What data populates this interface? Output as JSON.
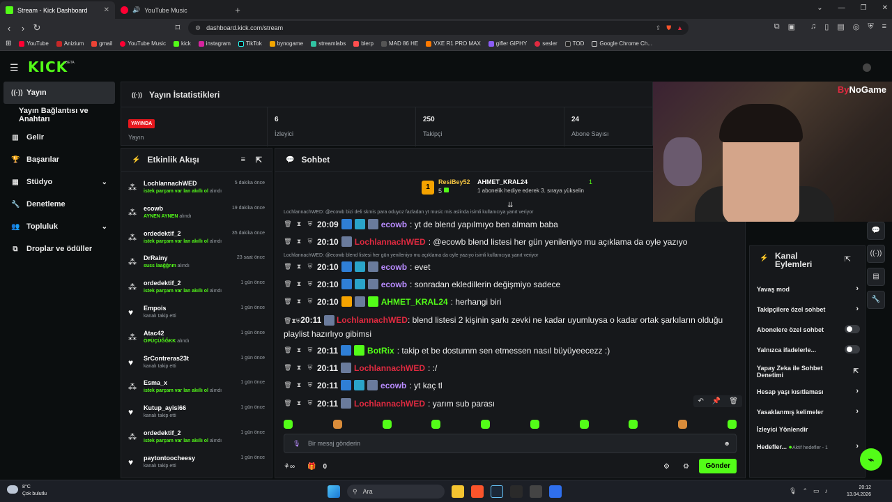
{
  "browser": {
    "tabs": [
      {
        "title": "Stream - Kick Dashboard",
        "close": "✕"
      },
      {
        "title": "YouTube Music"
      }
    ],
    "new_tab": "+",
    "url": "dashboard.kick.com/stream",
    "bookmarks": [
      "YouTube",
      "Anizium",
      "gmail",
      "YouTube Music",
      "kick",
      "instagram",
      "TikTok",
      "bynogame",
      "streamlabs",
      "blerp",
      "MAD 86 HE",
      "VXE R1 PRO MAX",
      "gifler GIPHY",
      "sesler",
      "TOD",
      "Google Chrome Ch..."
    ]
  },
  "app": {
    "logo": "KICK",
    "beta": "BETA"
  },
  "sidebar": {
    "items": [
      {
        "label": "Yayın",
        "icon": "broadcast-icon"
      },
      {
        "label": "Yayın Bağlantısı ve Anahtarı"
      },
      {
        "label": "Gelir",
        "icon": "chart-icon"
      },
      {
        "label": "Başarılar",
        "icon": "trophy-icon"
      },
      {
        "label": "Stüdyo",
        "icon": "studio-icon",
        "chevron": "⌄"
      },
      {
        "label": "Denetleme",
        "icon": "wrench-icon"
      },
      {
        "label": "Topluluk",
        "icon": "community-icon",
        "chevron": "⌄"
      },
      {
        "label": "Droplar ve ödüller",
        "icon": "drops-icon"
      }
    ]
  },
  "stats": {
    "title": "Yayın İstatistikleri",
    "live_badge": "YAYINDA",
    "cards": [
      {
        "value": "",
        "label": "Yayın"
      },
      {
        "value": "6",
        "label": "İzleyici"
      },
      {
        "value": "250",
        "label": "Takipçi"
      },
      {
        "value": "24",
        "label": "Abone Sayısı"
      }
    ]
  },
  "activity": {
    "title": "Etkinlik Akışı",
    "rows": [
      {
        "name": "LochlannachWED",
        "when": "5 dakika önce",
        "highlight": "istek parçam var lan akıllı ol",
        "suffix": "alındı",
        "icon": "redeem"
      },
      {
        "name": "ecowb",
        "when": "19 dakika önce",
        "highlight": "AYNEN AYNEN",
        "suffix": "alındı",
        "icon": "redeem"
      },
      {
        "name": "ordedektif_2",
        "when": "35 dakika önce",
        "highlight": "istek parçam var lan akıllı ol",
        "suffix": "alındı",
        "icon": "redeem"
      },
      {
        "name": "DrRainy",
        "when": "23 saat önce",
        "highlight": "suss laağğnm",
        "suffix": "alındı",
        "icon": "redeem"
      },
      {
        "name": "ordedektif_2",
        "when": "1 gün önce",
        "highlight": "istek parçam var lan akıllı ol",
        "suffix": "alındı",
        "icon": "redeem"
      },
      {
        "name": "Empois",
        "when": "1 gün önce",
        "highlight": "",
        "suffix": "kanalı takip etti",
        "icon": "heart"
      },
      {
        "name": "Atac42",
        "when": "1 gün önce",
        "highlight": "ÖPÜÇÜĞĞKK",
        "suffix": "alındı",
        "icon": "redeem"
      },
      {
        "name": "SrContreras23t",
        "when": "1 gün önce",
        "highlight": "",
        "suffix": "kanalı takip etti",
        "icon": "heart"
      },
      {
        "name": "Esma_x",
        "when": "1 gün önce",
        "highlight": "istek parçam var lan akıllı ol",
        "suffix": "alındı",
        "icon": "redeem"
      },
      {
        "name": "Kutup_ayisi66",
        "when": "1 gün önce",
        "highlight": "",
        "suffix": "kanalı takip etti",
        "icon": "heart"
      },
      {
        "name": "ordedektif_2",
        "when": "1 gün önce",
        "highlight": "istek parçam var lan akıllı ol",
        "suffix": "alındı",
        "icon": "redeem"
      },
      {
        "name": "paytontoocheesy",
        "when": "1 gün önce",
        "highlight": "",
        "suffix": "kanalı takip etti",
        "icon": "heart"
      }
    ]
  },
  "chat": {
    "title": "Sohbet",
    "pinned": {
      "user1": "ResiBey52",
      "count1": "5",
      "user2": "AHMET_KRAL24",
      "count2": "1",
      "note": "1 abonelik hediye ederek 3. sıraya yükselin"
    },
    "reply1": "LochlannachWED: @ecowb bizi deli skmis para oduyoz fazladan yt music mis aslinda isimli kullanıcıya yanıt veriyor",
    "reply2": "LochlannachWED: @ecowb blend listesi her gün yenileniyo mu açıklama da oyle yazıyo isimli kullanıcıya yanıt veriyor",
    "messages": [
      {
        "time": "20:09",
        "user": "ecowb",
        "color": "purple",
        "text": ": yt de blend yapılmıyo ben almam baba"
      },
      {
        "time": "20:10",
        "user": "LochlannachWED",
        "color": "red",
        "text": ": @ecowb blend listesi her gün yenileniyo mu açıklama da oyle yazıyo"
      },
      {
        "time": "20:10",
        "user": "ecowb",
        "color": "purple",
        "text": ": evet"
      },
      {
        "time": "20:10",
        "user": "ecowb",
        "color": "purple",
        "text": ": sonradan ekledillerin değişmiyo sadece"
      },
      {
        "time": "20:10",
        "user": "AHMET_KRAL24",
        "color": "green",
        "text": ": herhangi biri"
      },
      {
        "time": "20:11",
        "user": "LochlannachWED",
        "color": "red",
        "text": ": blend listesi 2 kişinin şarkı zevki ne kadar uyumluysa o kadar ortak şarkıların olduğu playlist hazırlıyo gibimsi"
      },
      {
        "time": "20:11",
        "user": "BotRix",
        "color": "green",
        "text": ": takip et be dostumm sen etmessen nasıl büyüyeecezz :)"
      },
      {
        "time": "20:11",
        "user": "LochlannachWED",
        "color": "red",
        "text": ": :/"
      },
      {
        "time": "20:11",
        "user": "ecowb",
        "color": "purple",
        "text": ": yt kaç tl"
      },
      {
        "time": "20:11",
        "user": "LochlannachWED",
        "color": "red",
        "text": ": yarım sub parası"
      }
    ],
    "input_placeholder": "Bir mesaj gönderin",
    "points": "0",
    "send_label": "Gönder"
  },
  "channel_actions": {
    "title": "Kanal Eylemleri",
    "items": [
      {
        "label": "Yavaş mod",
        "control": "chevron"
      },
      {
        "label": "Takipçilere özel sohbet",
        "control": "chevron"
      },
      {
        "label": "Abonelere özel sohbet",
        "control": "toggle"
      },
      {
        "label": "Yalnızca ifadelerle...",
        "control": "toggle"
      },
      {
        "label": "Yapay Zeka ile Sohbet Denetimi",
        "control": "external"
      },
      {
        "label": "Hesap yaşı kısıtlaması",
        "control": "chevron"
      },
      {
        "label": "Yasaklanmış kelimeler",
        "control": "chevron"
      },
      {
        "label": "İzleyici Yönlendir",
        "control": "none"
      },
      {
        "label": "Hedefler...",
        "control": "chevron",
        "extra": "Aktif hedefler - 1"
      }
    ]
  },
  "webcam": {
    "watermark_a": "By",
    "watermark_b": "NoGame"
  },
  "taskbar": {
    "temp": "8°C",
    "weather": "Çok bulutlu",
    "search": "Ara",
    "time": "20:12",
    "date": "13.04.2026"
  },
  "colors": {
    "accent": "#53fc18",
    "live": "#e7171d",
    "mention_red": "#e02a40",
    "purple": "#b98cff"
  }
}
